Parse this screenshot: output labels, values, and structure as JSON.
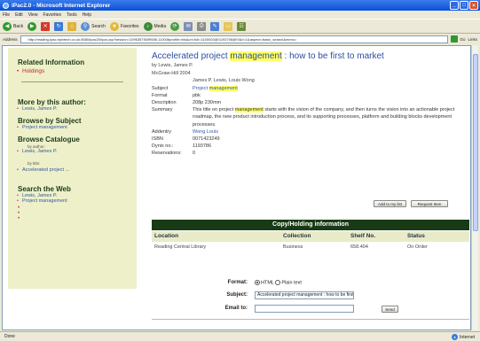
{
  "window": {
    "title": "iPac2.0 - Microsoft Internet Explorer",
    "min": "_",
    "max": "□",
    "close": "✕"
  },
  "menu": [
    "File",
    "Edit",
    "View",
    "Favorites",
    "Tools",
    "Help"
  ],
  "toolbar": {
    "back": "Back",
    "search": "Search",
    "favorites": "Favorites",
    "media": "Media"
  },
  "address": {
    "label": "Address",
    "url": "http://reading-ipac.epixtech.co.uk:8080/ipac20/ipac.jsp?session=1096357SMR656.110046profile=bls&uri=full=1100003@!1193706@!0&ri=1&aspect=basic_search&menu=",
    "go": "Go",
    "links": "Links"
  },
  "sidebar": {
    "related_heading": "Related Information",
    "holdings": "Holdings",
    "more_by_heading": "More by this author:",
    "more_by_author": "Lewis, James P.",
    "browse_subject_heading": "Browse by Subject",
    "subject_link": "Project management",
    "browse_catalogue_heading": "Browse Catalogue",
    "by_author_label": "by author:",
    "catalogue_author": "Lewis, James P.",
    "by_title_label": "by title:",
    "catalogue_title": "Accelerated project ...",
    "search_web_heading": "Search the Web",
    "web_author": "Lewis, James P.",
    "web_subject": "Project management",
    "bullet": "•"
  },
  "record": {
    "title_prefix": "Accelerated project ",
    "title_highlight": "management",
    "title_suffix": " : how to be first to market",
    "by_line": "by Lewis, James P.",
    "publisher": "McGraw-Hill 2004",
    "extra_authors": "James P. Lewis, Louis Wong",
    "fields": {
      "subject_label": "Subject",
      "subject_prefix": "Project ",
      "subject_highlight": "management",
      "format_label": "Format",
      "format_value": "pbk",
      "description_label": "Description",
      "description_value": "208p 230mm",
      "summary_label": "Summary",
      "summary_part1": "This title on project ",
      "summary_highlight": "management",
      "summary_part2": " starts with the vision of the company, and then turns the vision into an actionable project roadmap, the new product introduction process, and its supporting processes, platform and building blocks development processes.",
      "addentry_label": "Addentry",
      "addentry_value": "Wong Louis",
      "isbn_label": "ISBN",
      "isbn_value": "0071423249",
      "dynix_label": "Dynix no.:",
      "dynix_value": "1193786",
      "reservations_label": "Reservations:",
      "reservations_value": "0"
    },
    "add_to_list": "Add to my list",
    "request_item": "Request Item"
  },
  "copy": {
    "heading": "Copy/Holding information",
    "columns": [
      "Location",
      "Collection",
      "Shelf No.",
      "Status"
    ],
    "rows": [
      [
        "Reading Central Library",
        "Business",
        "658.404",
        "On Order"
      ]
    ]
  },
  "email_form": {
    "format_label": "Format:",
    "html_option": "HTML",
    "plain_option": "Plain text",
    "subject_label": "Subject:",
    "subject_value": "Accelerated project management : how to be first to market",
    "email_label": "Email to:",
    "email_placeholder": "",
    "send": "Send"
  },
  "status": {
    "text": "Done",
    "zone": "Internet"
  },
  "colors": {
    "accent_green": "#183a14",
    "sidebar_bg": "#eef0c9",
    "link_blue": "#2d4ea0",
    "highlight": "#ffff66"
  }
}
